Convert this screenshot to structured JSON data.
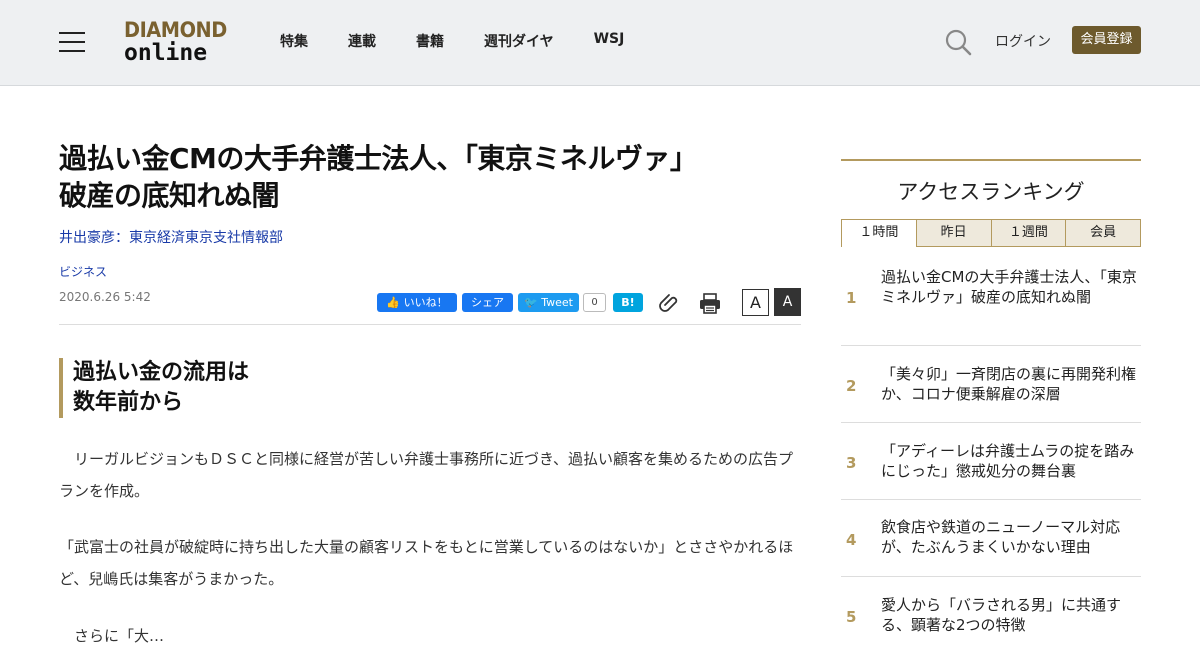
{
  "header": {
    "logo_line1": "DIAMOND",
    "logo_line2": "online",
    "nav": [
      "特集",
      "連載",
      "書籍",
      "週刊ダイヤ",
      "WSJ"
    ],
    "login": "ログイン",
    "register": "会員登録"
  },
  "article": {
    "title_line1": "過払い金CMの大手弁護士法人、「東京ミネルヴァ」",
    "title_line2": "破産の底知れぬ闇",
    "author": "井出豪彦：東京経済東京支社情報部",
    "category": "ビジネス",
    "date": "2020.6.26 5:42",
    "share": {
      "like": "いいね！",
      "share": "シェア",
      "tweet": "Tweet",
      "tweet_count": "0",
      "hatena": "B!"
    },
    "font_small": "A",
    "font_large": "A",
    "subhead_line1": "過払い金の流用は",
    "subhead_line2": "数年前から",
    "paragraphs": [
      "　リーガルビジョンもＤＳＣと同様に経営が苦しい弁護士事務所に近づき、過払い顧客を集めるための広告プランを作成。",
      "「武富士の社員が破綻時に持ち出した大量の顧客リストをもとに営業しているのはないか」とささやかれるほど、兒嶋氏は集客がうまかった。",
      "　さらに「大…"
    ]
  },
  "sidebar": {
    "title": "アクセスランキング",
    "tabs": [
      "１時間",
      "昨日",
      "１週間",
      "会員"
    ],
    "ranking": [
      {
        "num": "1",
        "text": "過払い金CMの大手弁護士法人、「東京ミネルヴァ」破産の底知れぬ闇"
      },
      {
        "num": "2",
        "text": "「美々卯」一斉閉店の裏に再開発利権か、コロナ便乗解雇の深層"
      },
      {
        "num": "3",
        "text": "「アディーレは弁護士ムラの掟を踏みにじった」懲戒処分の舞台裏"
      },
      {
        "num": "4",
        "text": "飲食店や鉄道のニューノーマル対応が、たぶんうまくいかない理由"
      },
      {
        "num": "5",
        "text": "愛人から「バラされる男」に共通する、顕著な2つの特徴"
      }
    ]
  },
  "colors": {
    "accent_gold": "#b39a5e",
    "register_bg": "#6d5a2d",
    "link_blue": "#1a3ba8",
    "facebook": "#1877f2",
    "twitter": "#1d9bf0",
    "hatena": "#00a4de"
  }
}
